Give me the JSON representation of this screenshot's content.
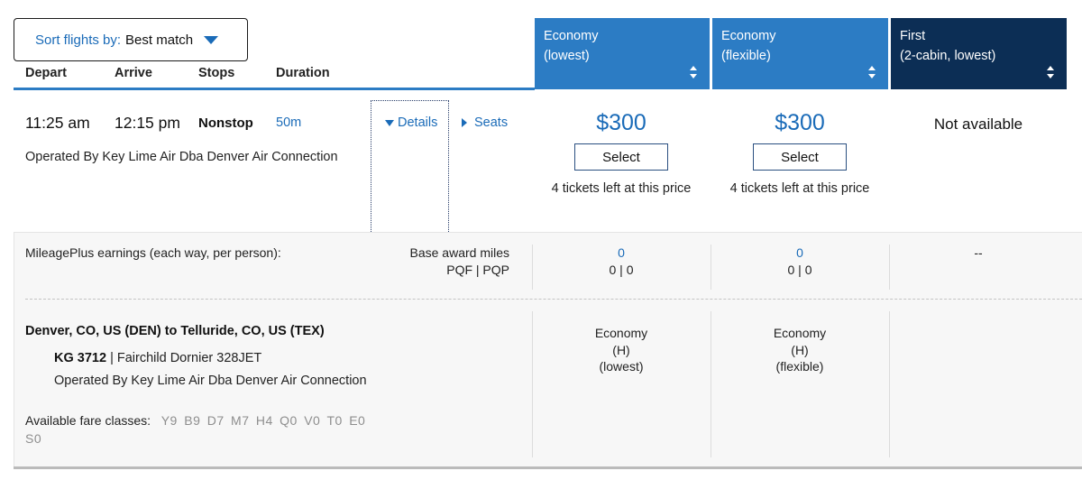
{
  "sort": {
    "label": "Sort flights by:",
    "value": "Best match"
  },
  "columns": [
    "Depart",
    "Arrive",
    "Stops",
    "Duration"
  ],
  "fares": [
    {
      "line1": "Economy",
      "line2": "(lowest)"
    },
    {
      "line1": "Economy",
      "line2": "(flexible)"
    },
    {
      "line1": "First",
      "line2": "(2-cabin, lowest)"
    }
  ],
  "flight": {
    "depart": "11:25 am",
    "arrive": "12:15 pm",
    "stops": "Nonstop",
    "duration": "50m",
    "operated": "Operated By Key Lime Air Dba Denver Air Connection",
    "details_link": "Details",
    "seats_link": "Seats",
    "prices": [
      {
        "price": "$300",
        "select": "Select",
        "tickets": "4 tickets left at this price"
      },
      {
        "price": "$300",
        "select": "Select",
        "tickets": "4 tickets left at this price"
      }
    ],
    "first_status": "Not available"
  },
  "details": {
    "earnings_label": "MileagePlus earnings (each way, per person):",
    "base_award": "Base award miles",
    "pqf_pqp": "PQF | PQP",
    "earnings": [
      {
        "miles": "0",
        "pq": "0 | 0"
      },
      {
        "miles": "0",
        "pq": "0 | 0"
      },
      {
        "miles": "--",
        "pq": ""
      }
    ],
    "route": "Denver, CO, US (DEN) to Telluride, CO, US (TEX)",
    "flight_number": "KG 3712",
    "aircraft": " | Fairchild Dornier 328JET",
    "operated": "Operated By Key Lime Air Dba Denver Air Connection",
    "fare_classes_label": "Available fare classes:",
    "fare_classes": "Y9 B9 D7 M7 H4 Q0 V0 T0 E0 S0",
    "cabins": [
      {
        "line1": "Economy",
        "line2": "(H)",
        "line3": "(lowest)"
      },
      {
        "line1": "Economy",
        "line2": "(H)",
        "line3": "(flexible)"
      }
    ]
  },
  "colors": {
    "accent": "#2c7cc4",
    "navy": "#0c2e55",
    "link": "#1a6bb8"
  }
}
